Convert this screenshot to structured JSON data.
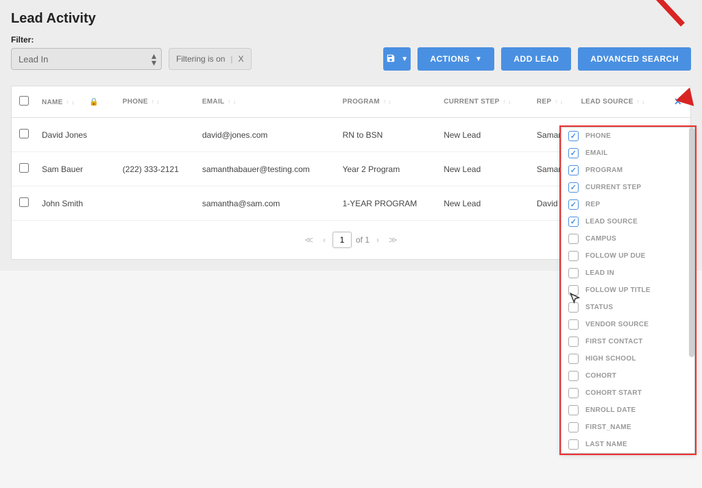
{
  "pageTitle": "Lead Activity",
  "filterLabel": "Filter:",
  "filterSelect": "Lead In",
  "filteringText": "Filtering is on",
  "filteringClose": "X",
  "buttons": {
    "actions": "ACTIONS",
    "addLead": "ADD LEAD",
    "advancedSearch": "ADVANCED SEARCH"
  },
  "columns": {
    "name": "NAME",
    "phone": "PHONE",
    "email": "EMAIL",
    "program": "PROGRAM",
    "currentStep": "CURRENT STEP",
    "rep": "REP",
    "leadSource": "LEAD SOURCE"
  },
  "rows": [
    {
      "name": "David Jones",
      "phone": "",
      "email": "david@jones.com",
      "program": "RN to BSN",
      "currentStep": "New Lead",
      "rep": "Samantha I"
    },
    {
      "name": "Sam Bauer",
      "phone": "(222) 333-2121",
      "email": "samanthabauer@testing.com",
      "program": "Year 2 Program",
      "currentStep": "New Lead",
      "rep": "Samantha I"
    },
    {
      "name": "John Smith",
      "phone": "",
      "email": "samantha@sam.com",
      "program": "1-YEAR PROGRAM",
      "currentStep": "New Lead",
      "rep": "David Stum"
    }
  ],
  "pagination": {
    "current": "1",
    "ofLabel": "of 1"
  },
  "columnMenu": [
    {
      "label": "PHONE",
      "checked": true
    },
    {
      "label": "EMAIL",
      "checked": true
    },
    {
      "label": "PROGRAM",
      "checked": true
    },
    {
      "label": "CURRENT STEP",
      "checked": true
    },
    {
      "label": "REP",
      "checked": true
    },
    {
      "label": "LEAD SOURCE",
      "checked": true
    },
    {
      "label": "CAMPUS",
      "checked": false
    },
    {
      "label": "FOLLOW UP DUE",
      "checked": false
    },
    {
      "label": "LEAD IN",
      "checked": false
    },
    {
      "label": "FOLLOW UP TITLE",
      "checked": false
    },
    {
      "label": "STATUS",
      "checked": false
    },
    {
      "label": "VENDOR SOURCE",
      "checked": false
    },
    {
      "label": "FIRST CONTACT",
      "checked": false
    },
    {
      "label": "HIGH SCHOOL",
      "checked": false
    },
    {
      "label": "COHORT",
      "checked": false
    },
    {
      "label": "COHORT START",
      "checked": false
    },
    {
      "label": "ENROLL DATE",
      "checked": false
    },
    {
      "label": "FIRST_NAME",
      "checked": false
    },
    {
      "label": "LAST NAME",
      "checked": false
    }
  ]
}
